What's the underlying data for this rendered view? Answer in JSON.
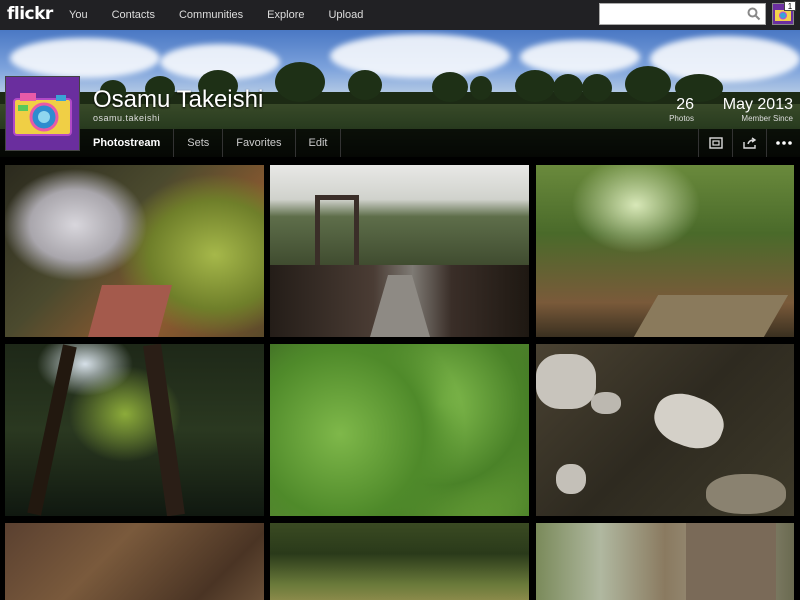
{
  "brand": {
    "logo": "flickr"
  },
  "nav": {
    "items": [
      {
        "label": "You"
      },
      {
        "label": "Contacts"
      },
      {
        "label": "Communities"
      },
      {
        "label": "Explore"
      },
      {
        "label": "Upload"
      }
    ]
  },
  "search": {
    "placeholder": "",
    "value": ""
  },
  "user_menu": {
    "notification_count": "1"
  },
  "profile": {
    "name": "Osamu Takeishi",
    "handle": "osamu.takeishi",
    "photos_count": "26",
    "photos_label": "Photos",
    "member_since": "May 2013",
    "member_since_label": "Member Since"
  },
  "subnav": {
    "tabs": [
      {
        "label": "Photostream",
        "active": true
      },
      {
        "label": "Sets"
      },
      {
        "label": "Favorites"
      },
      {
        "label": "Edit"
      }
    ],
    "tools": [
      "slideshow-icon",
      "share-icon",
      "more-icon"
    ]
  },
  "colors": {
    "topbar": "#212124",
    "background": "#000000",
    "avatar": "#6a2e9e"
  },
  "photos": [
    {
      "subject": "cherry blossoms over forest path"
    },
    {
      "subject": "wooden suspension bridge"
    },
    {
      "subject": "forest trail with green trees"
    },
    {
      "subject": "tall cedar trees looking up"
    },
    {
      "subject": "green leafy plants"
    },
    {
      "subject": "stream with rocks"
    },
    {
      "subject": "fallen leaves"
    },
    {
      "subject": "mossy forest floor"
    },
    {
      "subject": "tree trunks in woods"
    }
  ]
}
